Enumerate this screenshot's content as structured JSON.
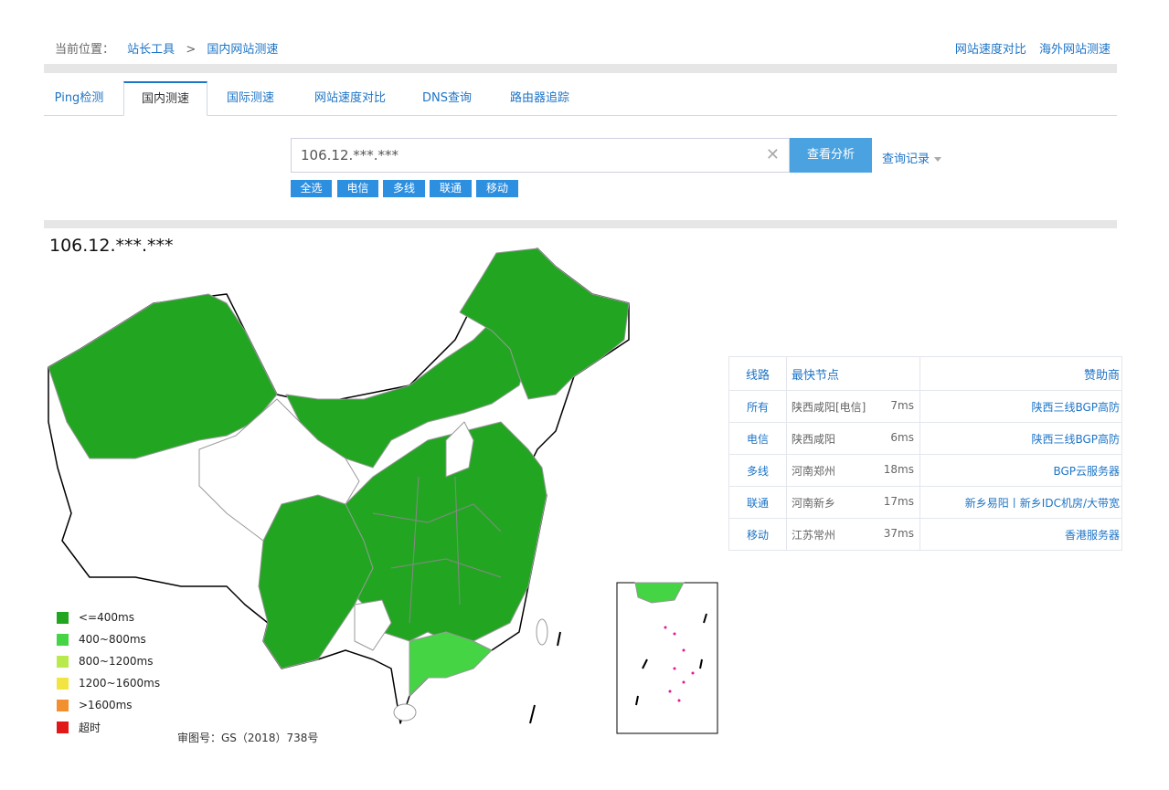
{
  "breadcrumb": {
    "prefix": "当前位置：",
    "home": "站长工具",
    "sep": ">",
    "current": "国内网站测速"
  },
  "top_links": [
    "网站速度对比",
    "海外网站测速"
  ],
  "tabs": [
    {
      "label": "Ping检测"
    },
    {
      "label": "国内测速",
      "active": true
    },
    {
      "label": "国际测速"
    },
    {
      "label": "网站速度对比"
    },
    {
      "label": "DNS查询"
    },
    {
      "label": "路由器追踪"
    }
  ],
  "search": {
    "value": "106.12.***.***",
    "clear_icon": "close-icon",
    "button": "查看分析",
    "history": "查询记录"
  },
  "line_filters": [
    "全选",
    "电信",
    "多线",
    "联通",
    "移动"
  ],
  "result_ip": "106.12.***.***",
  "legend": [
    {
      "label": "<=400ms",
      "color": "#22a622"
    },
    {
      "label": "400~800ms",
      "color": "#44d444"
    },
    {
      "label": "800~1200ms",
      "color": "#b8ea4e"
    },
    {
      "label": "1200~1600ms",
      "color": "#f2e542"
    },
    {
      "label": ">1600ms",
      "color": "#f29030"
    },
    {
      "label": "超时",
      "color": "#e01818"
    }
  ],
  "map_approval": "审图号：GS（2018）738号",
  "map_colors": {
    "fast": "#22a622",
    "medium": "#44d444",
    "none": "#ffffff",
    "border": "#999999"
  },
  "table": {
    "headers": [
      "线路",
      "最快节点",
      "赞助商"
    ],
    "rows": [
      {
        "line": "所有",
        "node": "陕西咸阳[电信]",
        "ms": "7ms",
        "sponsor": "陕西三线BGP高防"
      },
      {
        "line": "电信",
        "node": "陕西咸阳",
        "ms": "6ms",
        "sponsor": "陕西三线BGP高防"
      },
      {
        "line": "多线",
        "node": "河南郑州",
        "ms": "18ms",
        "sponsor": "BGP云服务器"
      },
      {
        "line": "联通",
        "node": "河南新乡",
        "ms": "17ms",
        "sponsor": "新乡易阳丨新乡IDC机房/大带宽"
      },
      {
        "line": "移动",
        "node": "江苏常州",
        "ms": "37ms",
        "sponsor": "香港服务器"
      }
    ]
  }
}
